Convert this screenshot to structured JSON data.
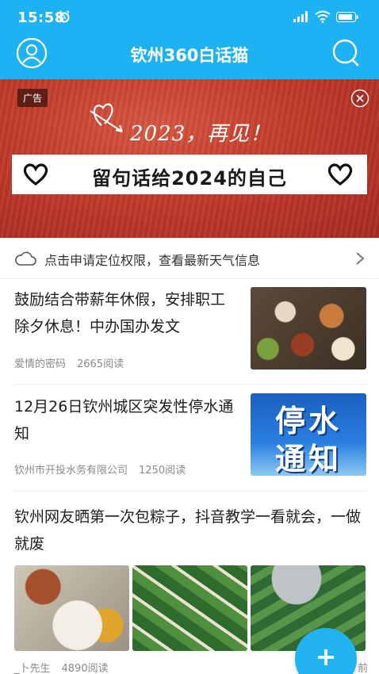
{
  "status_bar": {
    "time": "15:58",
    "icons": [
      "alarm-icon",
      "signal-icon",
      "wifi-icon",
      "battery-icon"
    ]
  },
  "header": {
    "title": "钦州360白话猫",
    "left_icon": "user-icon",
    "right_icon": "search-icon"
  },
  "banner": {
    "ad_label": "广告",
    "script_text": "2023，再见！",
    "headline": "留句话给2024的自己",
    "close_icon": "close-circle-icon"
  },
  "weather": {
    "text": "点击申请定位权限，查看最新天气信息"
  },
  "articles": [
    {
      "title": "鼓励结合带薪年休假，安排职工除夕休息！中办国办发文",
      "source": "爱情的密码",
      "reads": "2665阅读",
      "thumb": "food-feast"
    },
    {
      "title": "12月26日钦州城区突发性停水通知",
      "source": "钦州市开投水务有限公司",
      "reads": "1250阅读",
      "thumb_text_1": "停水",
      "thumb_text_2": "通知"
    },
    {
      "title": "钦州网友晒第一次包粽子，抖音教学一看就会，一做就废",
      "source": "_卜先生",
      "reads": "4890阅读",
      "tail": "前"
    }
  ],
  "fab": {
    "label": "+"
  },
  "colors": {
    "accent": "#1fb2f2",
    "banner_red": "#c23a2a"
  }
}
